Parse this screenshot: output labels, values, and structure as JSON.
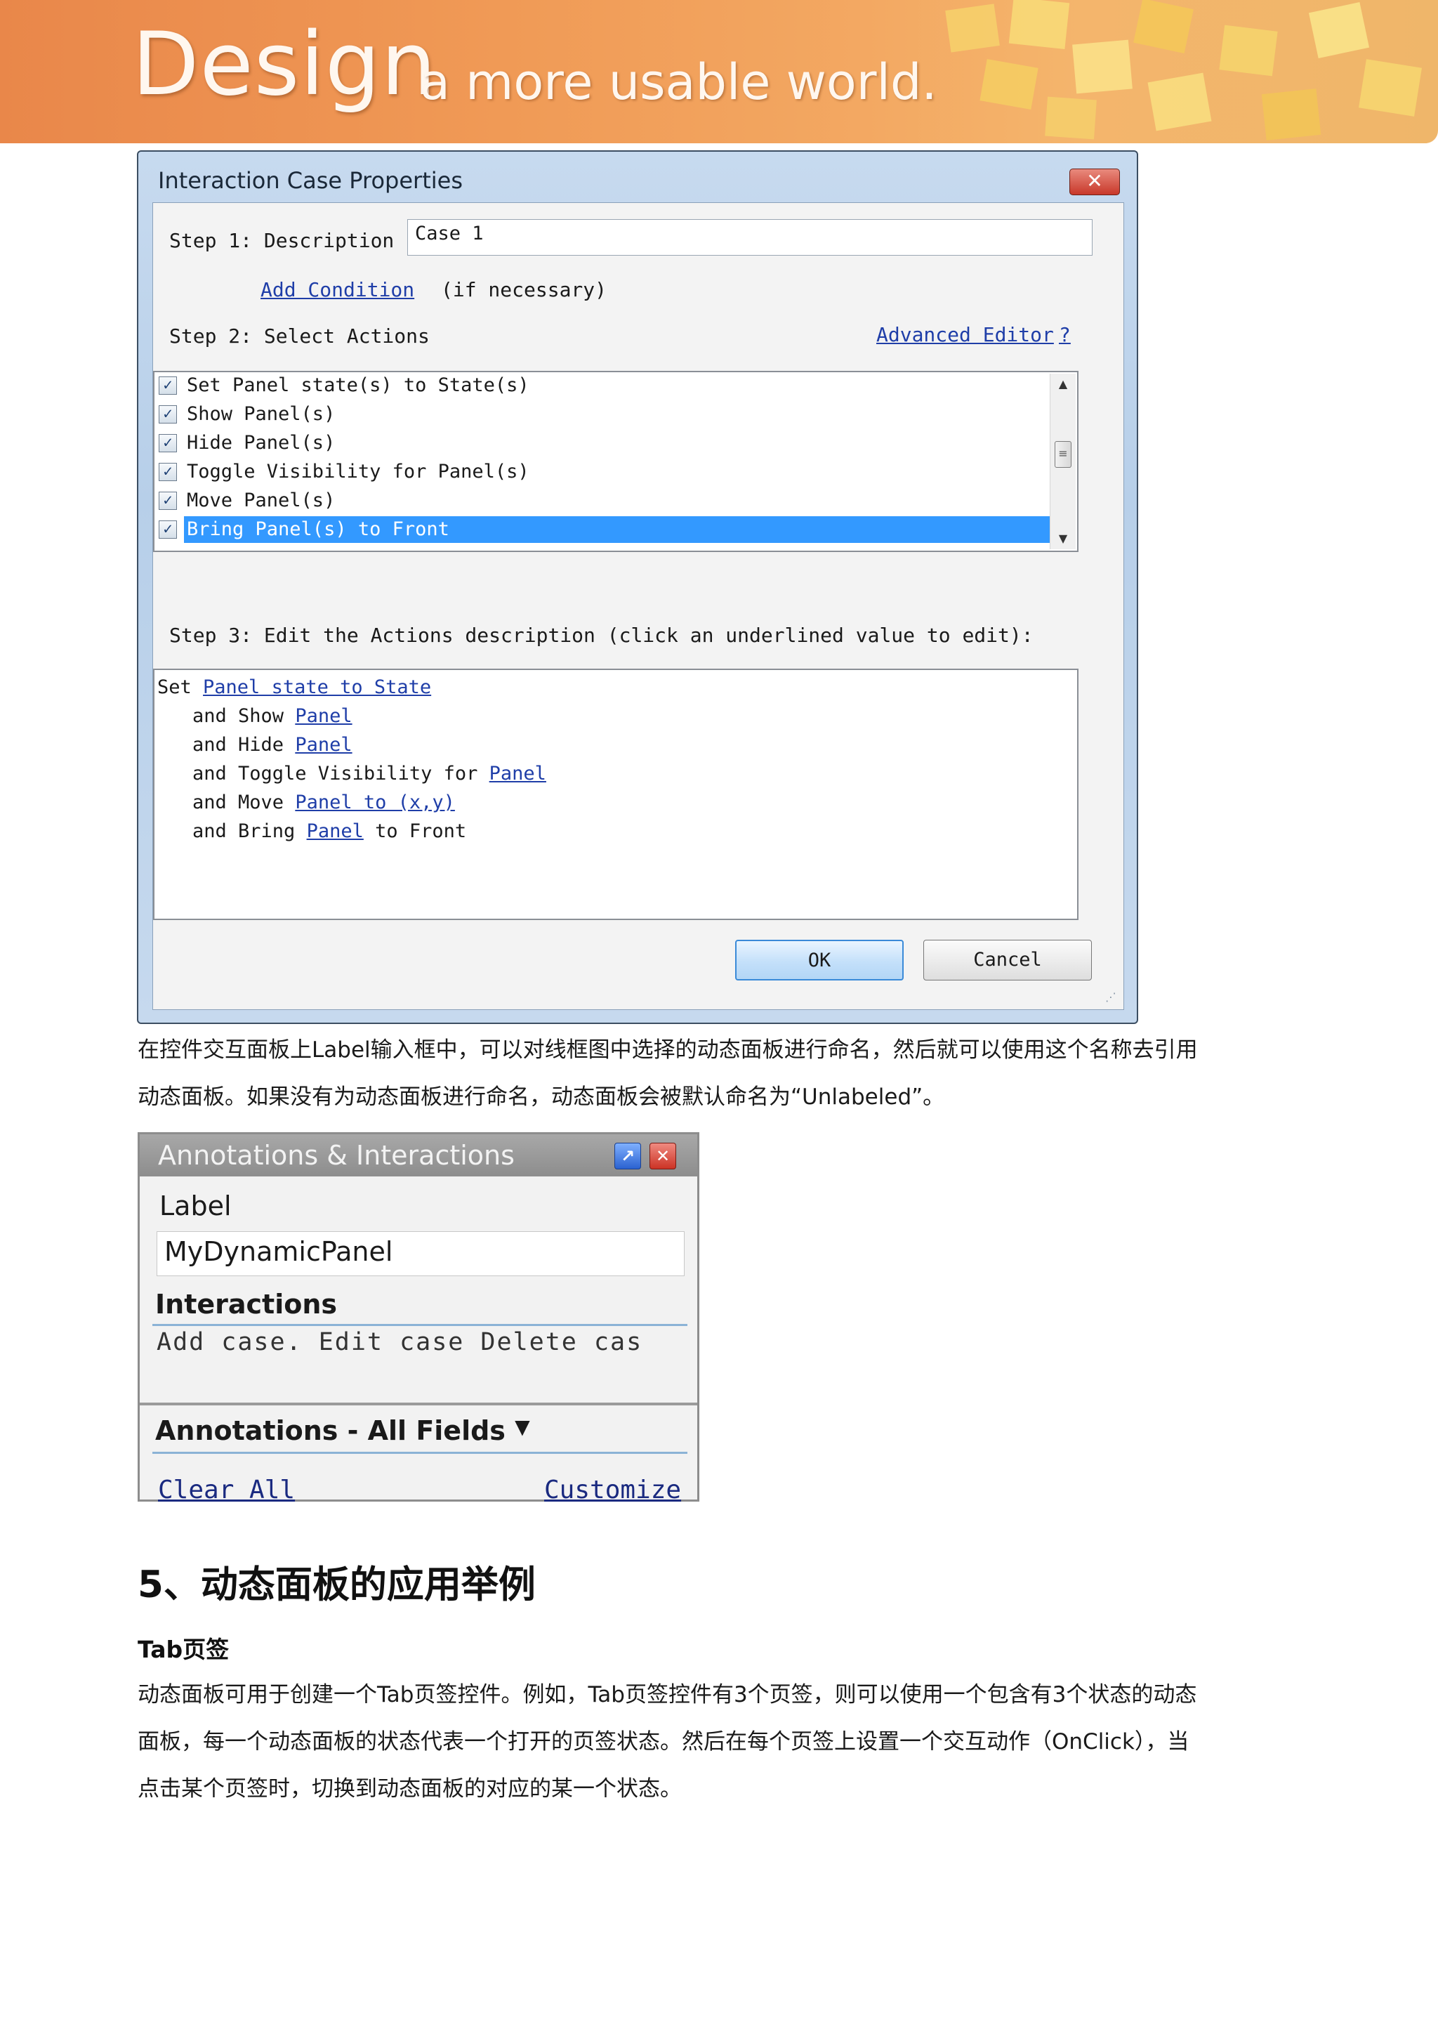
{
  "banner": {
    "logo_big": "Design",
    "logo_small": "a more usable world."
  },
  "dialog": {
    "title": "Interaction Case Properties",
    "close_glyph": "✕",
    "step1_label": "Step 1: Description",
    "description_value": "Case 1",
    "add_condition": "Add Condition",
    "if_necessary": "(if necessary)",
    "step2_label": "Step 2: Select Actions",
    "advanced_editor": "Advanced Editor",
    "help": "?",
    "actions": [
      {
        "label": "Set Panel state(s) to State(s)",
        "checked": true
      },
      {
        "label": "Show Panel(s)",
        "checked": true
      },
      {
        "label": "Hide Panel(s)",
        "checked": true
      },
      {
        "label": "Toggle Visibility for Panel(s)",
        "checked": true
      },
      {
        "label": "Move Panel(s)",
        "checked": true
      },
      {
        "label": "Bring Panel(s) to Front",
        "checked": true,
        "selected": true
      }
    ],
    "step3_label": "Step 3: Edit the Actions description (click an underlined value to edit):",
    "description_lines": [
      {
        "pre": "Set ",
        "link": "Panel state to State",
        "post": ""
      },
      {
        "pre": "and Show ",
        "link": "Panel",
        "post": ""
      },
      {
        "pre": "and Hide ",
        "link": "Panel",
        "post": ""
      },
      {
        "pre": "and Toggle Visibility for ",
        "link": "Panel",
        "post": ""
      },
      {
        "pre": "and Move ",
        "link": "Panel to (x,y)",
        "post": ""
      },
      {
        "pre": "and Bring ",
        "link": "Panel",
        "post": " to Front"
      }
    ],
    "ok": "OK",
    "cancel": "Cancel"
  },
  "paragraph1": [
    "在控件交互面板上Label输入框中，可以对线框图中选择的动态面板进行命名，然后就可以使用这个名称去引用",
    "动态面板。如果没有为动态面板进行命名，动态面板会被默认命名为“Unlabeled”。"
  ],
  "annotations_panel": {
    "title": "Annotations & Interactions",
    "label": "Label",
    "label_value": "MyDynamicPanel",
    "interactions": "Interactions",
    "cases_text": "Add case. Edit case Delete cas",
    "annotations_header": "Annotations - All Fields",
    "dropdown_glyph": "▼",
    "clear_all": "Clear All",
    "customize": "Customize"
  },
  "section": {
    "heading": "5、动态面板的应用举例",
    "subheading": "Tab页签",
    "paragraph": [
      "动态面板可用于创建一个Tab页签控件。例如，Tab页签控件有3个页签，则可以使用一个包含有3个状态的动态",
      "面板，每一个动态面板的状态代表一个打开的页签状态。然后在每个页签上设置一个交互动作（OnClick），当",
      "点击某个页签时，切换到动态面板的对应的某一个状态。"
    ]
  }
}
